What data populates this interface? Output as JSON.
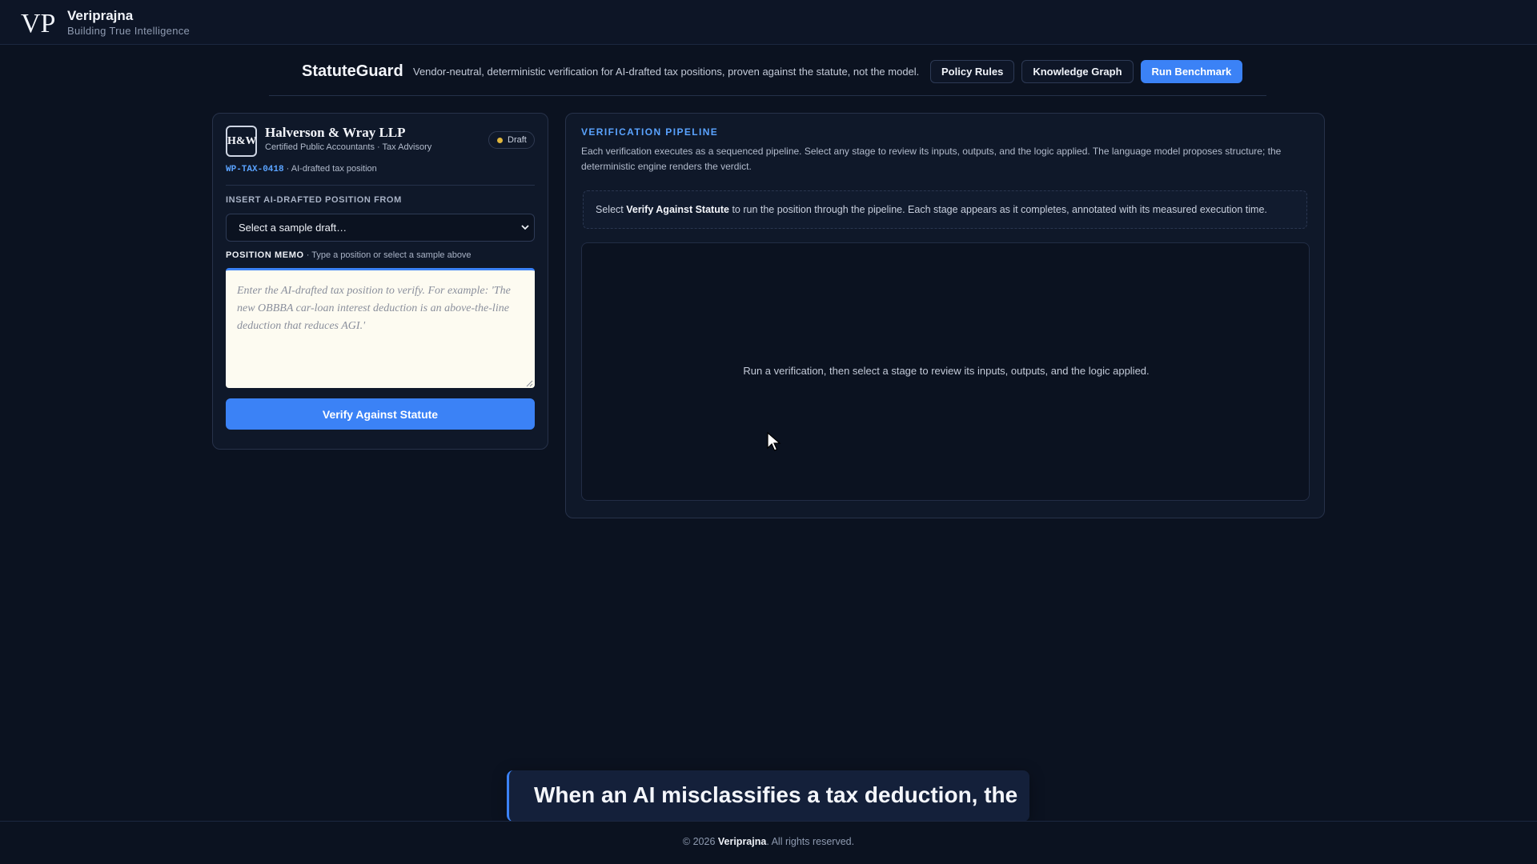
{
  "brand": {
    "logo_text": "VP",
    "name": "Veriprajna",
    "tagline": "Building True Intelligence"
  },
  "app": {
    "title": "StatuteGuard",
    "subtitle": "Vendor-neutral, deterministic verification for AI-drafted tax positions, proven against the statute, not the model.",
    "buttons": {
      "policy_rules": "Policy Rules",
      "knowledge_graph": "Knowledge Graph",
      "run_benchmark": "Run Benchmark"
    }
  },
  "left": {
    "firm_logo": "H&W",
    "firm_name": "Halverson & Wray LLP",
    "firm_desc": "Certified Public Accountants · Tax Advisory",
    "status_badge": "Draft",
    "ref_code": "WP-TAX-0418",
    "ref_desc": " · AI-drafted tax position",
    "insert_label": "INSERT AI-DRAFTED POSITION FROM",
    "select_value": "Select a sample draft…",
    "memo_label": "POSITION MEMO",
    "memo_hint": " · Type a position or select a sample above",
    "memo_placeholder": "Enter the AI-drafted tax position to verify. For example: 'The new OBBBA car-loan interest deduction is an above-the-line deduction that reduces AGI.'",
    "verify_button": "Verify Against Statute"
  },
  "right": {
    "title": "VERIFICATION PIPELINE",
    "description": "Each verification executes as a sequenced pipeline. Select any stage to review its inputs, outputs, and the logic applied. The language model proposes structure; the deterministic engine renders the verdict.",
    "hint_prefix": "Select ",
    "hint_bold": "Verify Against Statute",
    "hint_suffix": " to run the position through the pipeline. Each stage appears as it completes, annotated with its measured execution time.",
    "empty_state": "Run a verification, then select a stage to review its inputs, outputs, and the logic applied."
  },
  "caption": {
    "text": "When an AI misclassifies a tax deduction, the"
  },
  "footer": {
    "prefix": "© 2026 ",
    "brand": "Veriprajna",
    "suffix": ". All rights reserved."
  },
  "colors": {
    "background": "#0b1220",
    "accent": "#3b82f6",
    "link": "#5aa3ff",
    "draft_dot": "#e0b63c"
  }
}
